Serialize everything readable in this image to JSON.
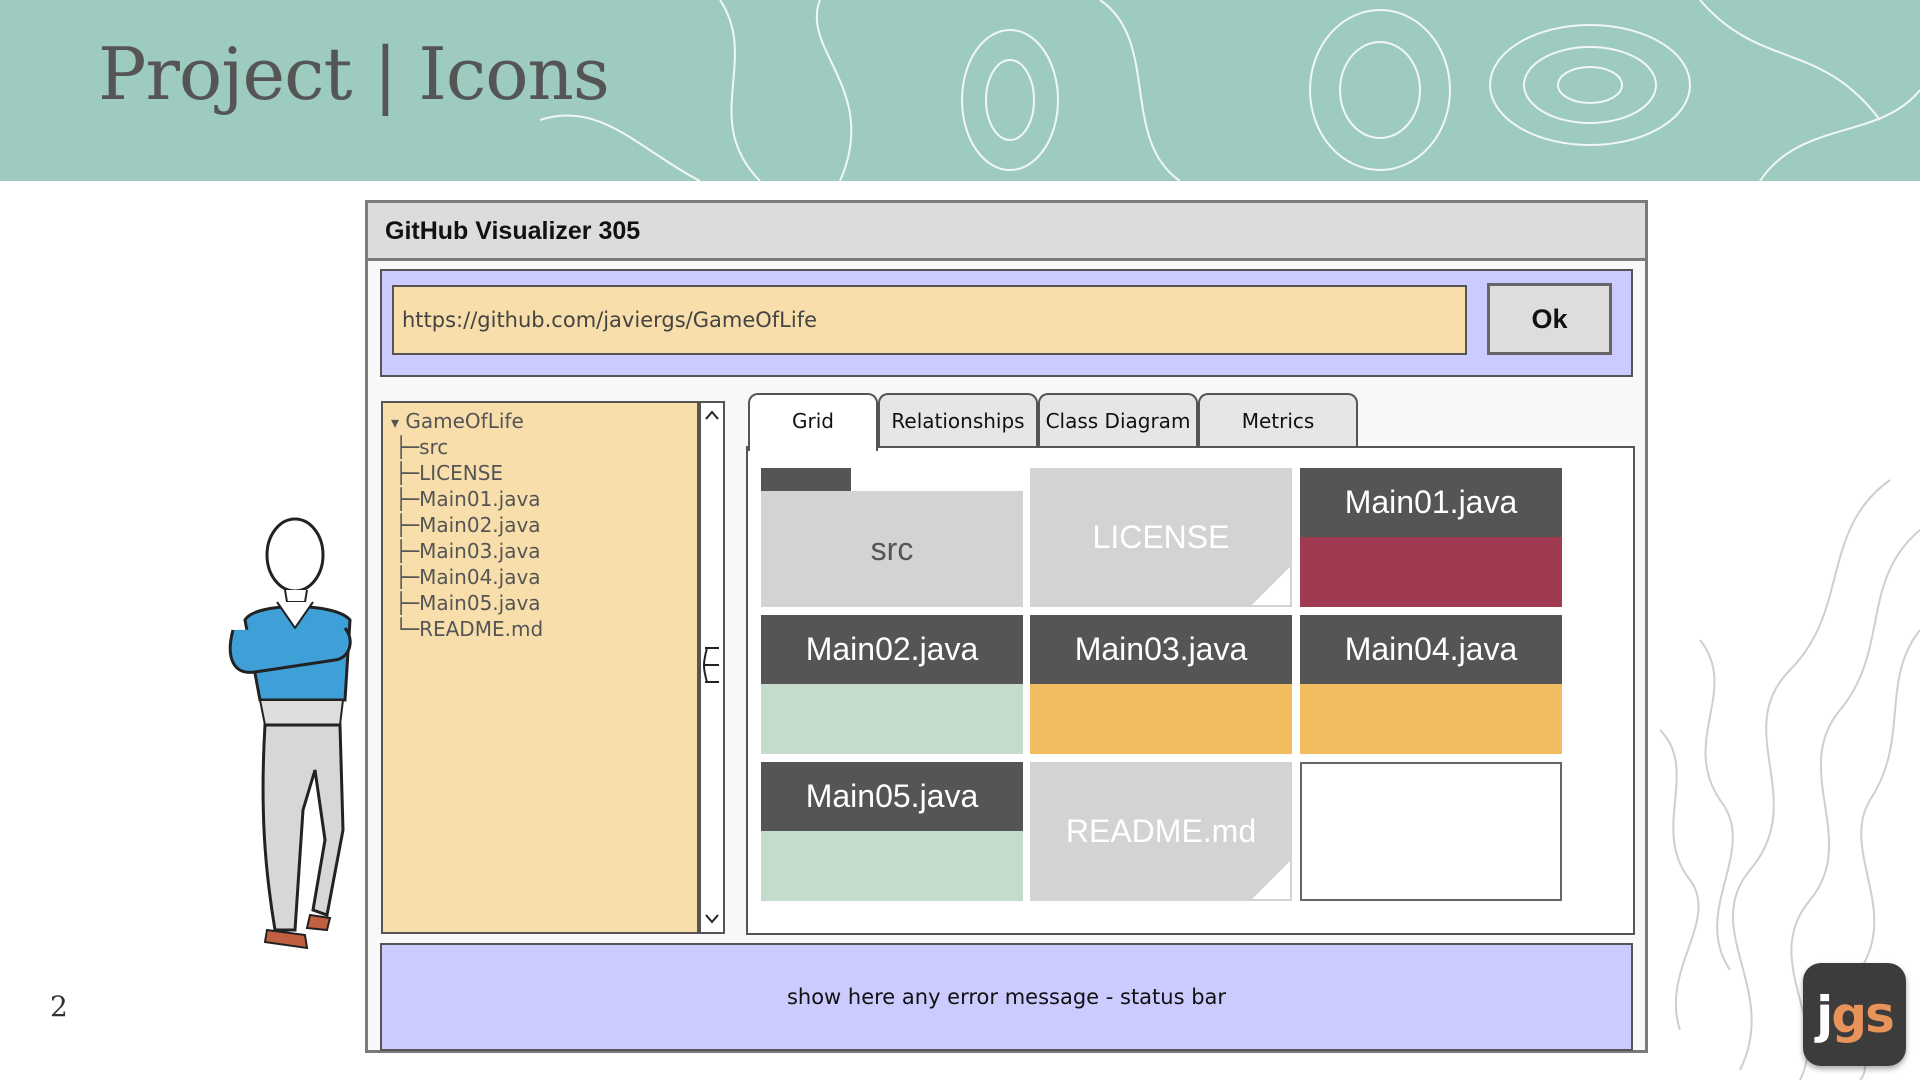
{
  "slide": {
    "title": "Project | Icons",
    "page_number": "2"
  },
  "logo": {
    "j": "j",
    "gs": "gs"
  },
  "window": {
    "title": "GitHub Visualizer 305",
    "url_value": "https://github.com/javiergs/GameOfLife",
    "ok_label": "Ok",
    "status_text": "show here any error message - status bar"
  },
  "tree": {
    "root": "GameOfLife",
    "expand_glyph": "▾",
    "branch_glyph": "├─",
    "last_branch_glyph": "└─",
    "items": [
      "src",
      "LICENSE",
      "Main01.java",
      "Main02.java",
      "Main03.java",
      "Main04.java",
      "Main05.java",
      "README.md"
    ]
  },
  "tabs": [
    "Grid",
    "Relationships",
    "Class Diagram",
    "Metrics"
  ],
  "active_tab": "Grid",
  "grid": [
    {
      "label": "src",
      "kind": "folder"
    },
    {
      "label": "LICENSE",
      "kind": "document"
    },
    {
      "label": "Main01.java",
      "kind": "java",
      "color": "#a03a50"
    },
    {
      "label": "Main02.java",
      "kind": "java",
      "color": "#c5dccd"
    },
    {
      "label": "Main03.java",
      "kind": "java",
      "color": "#efbd5d"
    },
    {
      "label": "Main04.java",
      "kind": "java",
      "color": "#efbd5d"
    },
    {
      "label": "Main05.java",
      "kind": "java",
      "color": "#c5dccd"
    },
    {
      "label": "README.md",
      "kind": "document"
    },
    {
      "label": "",
      "kind": "empty"
    }
  ],
  "colors": {
    "banner": "#9dcbbf",
    "panel_lavender": "#cccbff",
    "field_tan": "#f7deaa",
    "tile_dark": "#555555",
    "tile_light": "#d3d3d3"
  }
}
